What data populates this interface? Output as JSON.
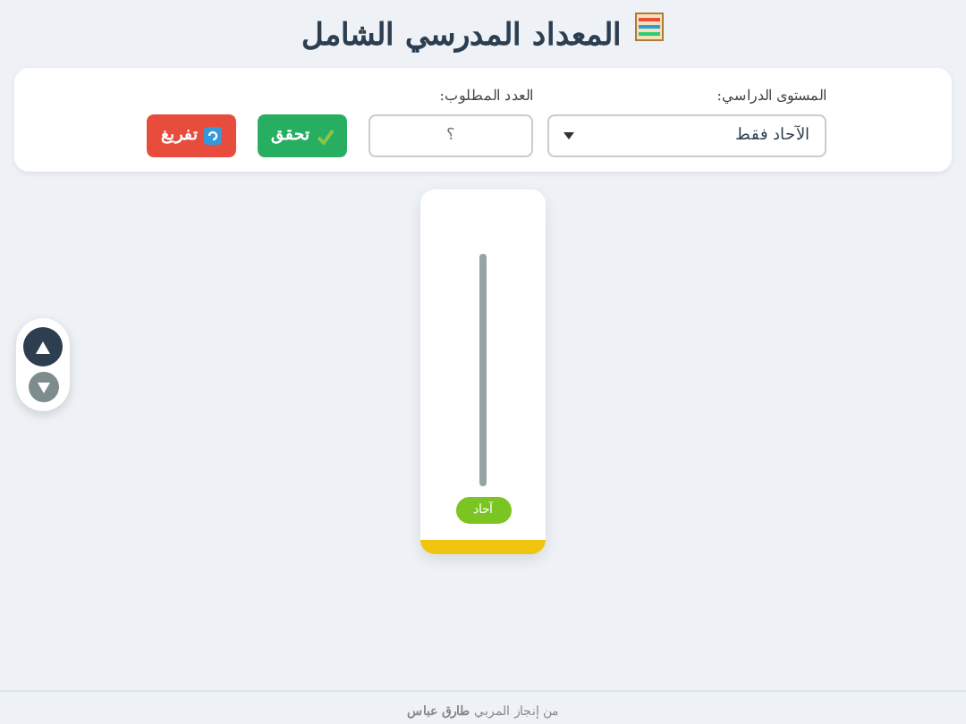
{
  "title": "المعداد المدرسي الشامل",
  "controls": {
    "level_label": "المستوى الدراسي:",
    "level_value": "الآحاد فقط",
    "number_label": "العدد المطلوب:",
    "number_placeholder": "؟"
  },
  "buttons": [
    {
      "kind": "check",
      "label": "تحقق"
    },
    {
      "kind": "reset",
      "label": "تفريغ"
    }
  ],
  "rods": [
    {
      "label": "آحاد"
    }
  ],
  "arrows": [
    {
      "kind": "up",
      "disabled": false
    },
    {
      "kind": "down",
      "disabled": true
    }
  ],
  "footer": "من إنجاز المربي **طارق عباس**"
}
